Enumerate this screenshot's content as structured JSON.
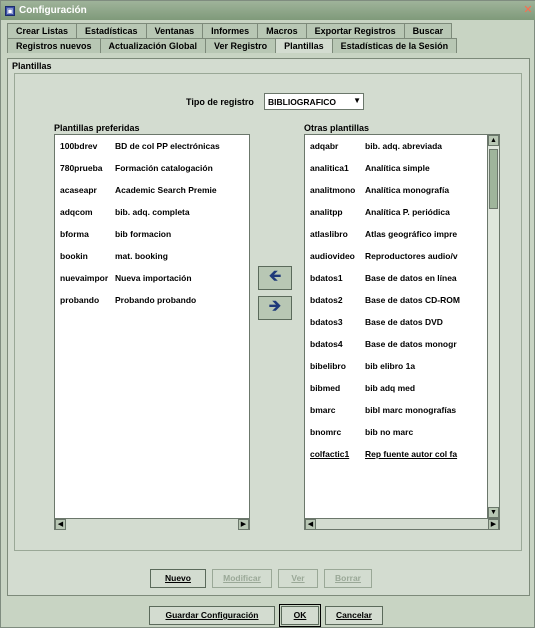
{
  "window": {
    "title": "Configuración",
    "close_glyph": "✕"
  },
  "tabs_row1": [
    "Crear Listas",
    "Estadísticas",
    "Ventanas",
    "Informes",
    "Macros",
    "Exportar Registros",
    "Buscar"
  ],
  "tabs_row2": [
    "Registros nuevos",
    "Actualización Global",
    "Ver Registro",
    "Plantillas",
    "Estadísticas de la Sesión"
  ],
  "active_tab": "Plantillas",
  "section_title": "Plantillas",
  "tipo": {
    "label": "Tipo de registro",
    "value": "BIBLIOGRAFICO"
  },
  "preferred": {
    "label": "Plantillas preferidas",
    "rows": [
      [
        "100bdrev",
        "BD de col PP electrónicas"
      ],
      [
        "780prueba",
        "Formación catalogación"
      ],
      [
        "acaseapr",
        "Academic Search Premie"
      ],
      [
        "adqcom",
        "bib. adq. completa"
      ],
      [
        "bforma",
        "bib formacion"
      ],
      [
        "bookin",
        "mat. booking"
      ],
      [
        "nuevaimpor",
        "Nueva importación"
      ],
      [
        "probando",
        "Probando probando"
      ]
    ]
  },
  "others": {
    "label": "Otras plantillas",
    "rows": [
      [
        "adqabr",
        "bib. adq. abreviada"
      ],
      [
        "analitica1",
        "Analítica simple"
      ],
      [
        "analitmono",
        "Analítica monografía"
      ],
      [
        "analitpp",
        "Analítica P. periódica"
      ],
      [
        "atlaslibro",
        "Atlas geográfico impre"
      ],
      [
        "audiovideo",
        "Reproductores audio/v"
      ],
      [
        "bdatos1",
        "Base de datos en línea"
      ],
      [
        "bdatos2",
        "Base de datos CD-ROM"
      ],
      [
        "bdatos3",
        "Base de datos DVD"
      ],
      [
        "bdatos4",
        "Base de datos monogr"
      ],
      [
        "bibelibro",
        "bib elibro 1a"
      ],
      [
        "bibmed",
        "bib adq med"
      ],
      [
        "bmarc",
        "bibl marc monografías"
      ],
      [
        "bnomrc",
        "bib no marc"
      ],
      [
        "colfactic1",
        "Rep fuente autor col fa"
      ]
    ]
  },
  "move_left_glyph": "🡸",
  "move_right_glyph": "🡺",
  "template_buttons": {
    "nuevo": "Nuevo",
    "modificar": "Modificar",
    "ver": "Ver",
    "borrar": "Borrar"
  },
  "footer_buttons": {
    "guardar": "Guardar Configuración",
    "ok": "OK",
    "cancelar": "Cancelar"
  },
  "icons": {
    "app": "app-icon",
    "close": "close-icon",
    "dropdown": "chevron-down-icon",
    "arrow_left": "arrow-left-icon",
    "arrow_right": "arrow-right-icon"
  }
}
